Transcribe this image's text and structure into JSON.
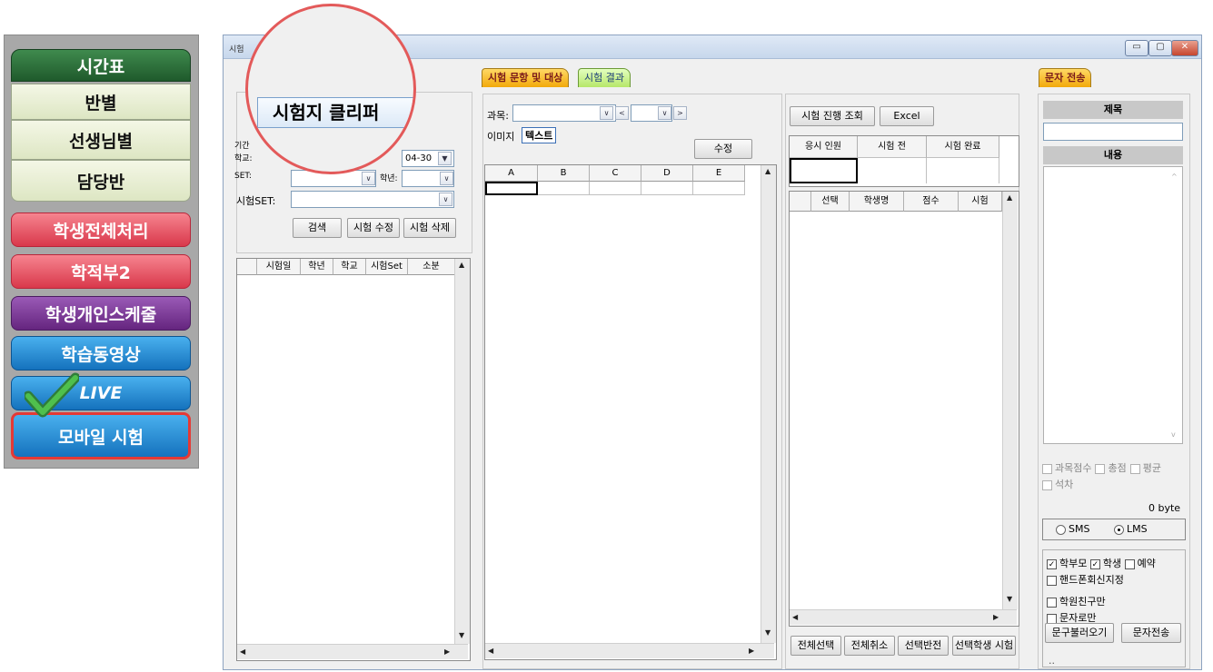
{
  "left_menu": {
    "items": [
      {
        "label": "시간표",
        "style": "dark"
      },
      {
        "label": "반별",
        "style": "light"
      },
      {
        "label": "선생님별",
        "style": "light"
      },
      {
        "label": "담당반",
        "style": "light"
      },
      {
        "label": "학생전체처리",
        "style": "red"
      },
      {
        "label": "학적부2",
        "style": "red"
      },
      {
        "label": "학생개인스케줄",
        "style": "purple"
      },
      {
        "label": "학습동영상",
        "style": "blue"
      },
      {
        "label": "LIVE",
        "style": "blue"
      },
      {
        "label": "모바일 시험",
        "style": "blue",
        "highlighted": true
      }
    ],
    "check_icon": "checkmark-icon"
  },
  "window": {
    "title_fragment": "시험",
    "controls": {
      "minimize": "▭",
      "maximize": "▢",
      "close": "✕"
    }
  },
  "magnifier": {
    "label": "시험지 클리퍼"
  },
  "left_panel": {
    "partial_labels": {
      "period": "기간",
      "school": "학교:",
      "set": "SET:",
      "grade": "학년:"
    },
    "date_partial": "04-30",
    "test_set_label": "시험SET:",
    "buttons": {
      "search": "검색",
      "edit": "시험 수정",
      "delete": "시험 삭제"
    },
    "grid_columns": [
      "시험일",
      "학년",
      "학교",
      "시험Set",
      "소분"
    ]
  },
  "center_panel": {
    "tabs": {
      "active": "시험 문항 및 대상",
      "inactive": "시험 결과"
    },
    "subject_label": "과목:",
    "mode": {
      "image": "이미지",
      "text": "텍스트"
    },
    "edit_button": "수정",
    "grid_columns": [
      "A",
      "B",
      "C",
      "D",
      "E"
    ]
  },
  "right_panel": {
    "buttons": {
      "status": "시험 진행 조회",
      "excel": "Excel"
    },
    "status_columns": [
      "응시 인원",
      "시험 전",
      "시험 완료"
    ],
    "grid_columns": [
      "선택",
      "학생명",
      "점수",
      "시험"
    ],
    "bottom_buttons": {
      "select_all": "전체선택",
      "cancel_all": "전체취소",
      "invert": "선택반전",
      "selected_test": "선택학생 시험"
    }
  },
  "sms_panel": {
    "tab": "문자 전송",
    "title_header": "제목",
    "content_header": "내용",
    "checks": {
      "subject_score": "과목점수",
      "total": "총점",
      "average": "평균",
      "rank": "석차"
    },
    "byte_count": "0 byte",
    "radio": {
      "sms": "SMS",
      "lms": "LMS",
      "selected": "LMS"
    },
    "recipients": {
      "parent": "학부모",
      "student": "학생",
      "reserve": "예약",
      "phone_designate": "핸드폰회신지정",
      "academy_friend": "학원친구만",
      "sms_only": "문자로만"
    },
    "buttons": {
      "load_phrase": "문구불러오기",
      "send": "문자전송"
    },
    "footer": ".."
  }
}
